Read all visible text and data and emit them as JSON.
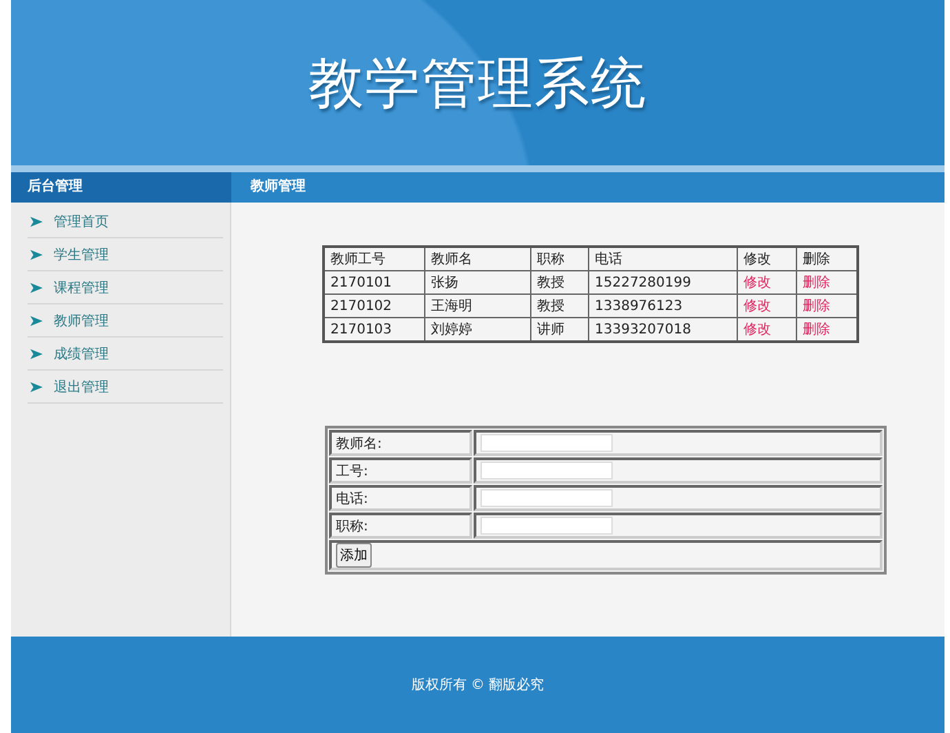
{
  "header": {
    "title": "教学管理系统"
  },
  "sidebar": {
    "title": "后台管理",
    "items": [
      {
        "label": "管理首页"
      },
      {
        "label": "学生管理"
      },
      {
        "label": "课程管理"
      },
      {
        "label": "教师管理"
      },
      {
        "label": "成绩管理"
      },
      {
        "label": "退出管理"
      }
    ]
  },
  "content": {
    "title": "教师管理",
    "table": {
      "columns": [
        "教师工号",
        "教师名",
        "职称",
        "电话",
        "修改",
        "删除"
      ],
      "rows": [
        {
          "cells": [
            "2170101",
            "张扬",
            "教授",
            "15227280199"
          ],
          "actions": [
            "修改",
            "删除"
          ]
        },
        {
          "cells": [
            "2170102",
            "王海明",
            "教授",
            "1338976123"
          ],
          "actions": [
            "修改",
            "删除"
          ]
        },
        {
          "cells": [
            "2170103",
            "刘婷婷",
            "讲师",
            "13393207018"
          ],
          "actions": [
            "修改",
            "删除"
          ]
        }
      ]
    },
    "form": {
      "fields": [
        {
          "label": "教师名:"
        },
        {
          "label": "工号:"
        },
        {
          "label": "电话:"
        },
        {
          "label": "职称:"
        }
      ],
      "button": "添加"
    }
  },
  "footer": {
    "text": "版权所有 © 翻版必究"
  }
}
